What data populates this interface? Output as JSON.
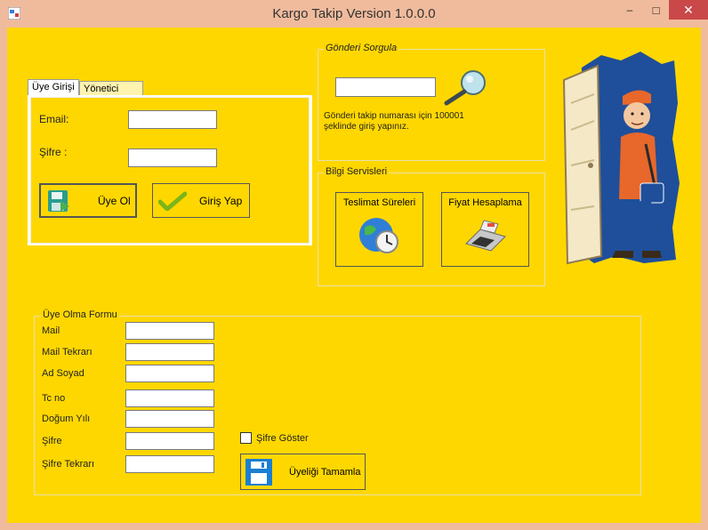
{
  "window": {
    "title": "Kargo Takip Version 1.0.0.0",
    "minimize": "–",
    "maximize": "□",
    "close": "✕"
  },
  "tabs": [
    "Üye Girişi",
    "Yönetici Girişi"
  ],
  "login": {
    "email_label": "Email:",
    "email_value": "",
    "password_label": "Şifre :",
    "password_value": "",
    "register_button": "Üye Ol",
    "login_button": "Giriş Yap"
  },
  "query": {
    "title": "Gönderi Sorgula",
    "tracking_value": "",
    "hint_line1": "Gönderi takip numarası için 100001",
    "hint_line2": "şeklinde giriş yapınız."
  },
  "info": {
    "title": "Bilgi Servisleri",
    "delivery_button": "Teslimat Süreleri",
    "price_button": "Fiyat Hesaplama"
  },
  "signup": {
    "title": "Üye Olma Formu",
    "fields": [
      "Mail",
      "Mail Tekrarı",
      "Ad Soyad",
      "Tc no",
      "Doğum Yılı",
      "Şifre",
      "Şifre Tekrarı"
    ],
    "show_password": "Şifre Göster",
    "show_password_checked": false,
    "complete_button": "Üyeliği Tamamla"
  },
  "colors": {
    "background": "#ffd700",
    "titlebar": "#f0bb9d",
    "close": "#c9484a"
  }
}
